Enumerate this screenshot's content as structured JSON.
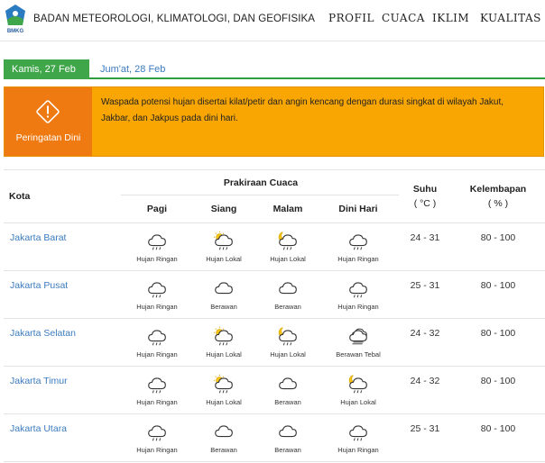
{
  "header": {
    "logo_text": "BMKG",
    "org_name": "BADAN METEOROLOGI, KLIMATOLOGI, DAN GEOFISIKA",
    "nav": [
      "PROFIL",
      "CUACA",
      "IKLIM",
      "KUALITAS UD"
    ]
  },
  "tabs": {
    "active": "Kamis, 27 Feb",
    "other": "Jum'at, 28 Feb"
  },
  "warning": {
    "icon": "warning-diamond-icon",
    "label": "Peringatan Dini",
    "text": "Waspada potensi hujan disertai kilat/petir dan angin kencang dengan durasi singkat di wilayah Jakut, Jakbar, dan Jakpus pada  dini hari."
  },
  "table": {
    "col_city": "Kota",
    "col_forecast": "Prakiraan Cuaca",
    "periods": [
      "Pagi",
      "Siang",
      "Malam",
      "Dini Hari"
    ],
    "col_temp": [
      "Suhu",
      "( °C )"
    ],
    "col_humidity": [
      "Kelembapan",
      "( % )"
    ],
    "rows": [
      {
        "city": "Jakarta Barat",
        "weather": [
          {
            "icon": "light-rain-icon",
            "label": "Hujan Ringan"
          },
          {
            "icon": "sun-rain-icon",
            "label": "Hujan Lokal"
          },
          {
            "icon": "moon-rain-icon",
            "label": "Hujan Lokal"
          },
          {
            "icon": "light-rain-icon",
            "label": "Hujan Ringan"
          }
        ],
        "temp": "24 - 31",
        "humidity": "80 - 100"
      },
      {
        "city": "Jakarta Pusat",
        "weather": [
          {
            "icon": "light-rain-icon",
            "label": "Hujan Ringan"
          },
          {
            "icon": "cloud-icon",
            "label": "Berawan"
          },
          {
            "icon": "cloud-icon",
            "label": "Berawan"
          },
          {
            "icon": "light-rain-icon",
            "label": "Hujan Ringan"
          }
        ],
        "temp": "25 - 31",
        "humidity": "80 - 100"
      },
      {
        "city": "Jakarta Selatan",
        "weather": [
          {
            "icon": "light-rain-icon",
            "label": "Hujan Ringan"
          },
          {
            "icon": "sun-rain-icon",
            "label": "Hujan Lokal"
          },
          {
            "icon": "moon-rain-icon",
            "label": "Hujan Lokal"
          },
          {
            "icon": "heavy-cloud-icon",
            "label": "Berawan Tebal"
          }
        ],
        "temp": "24 - 32",
        "humidity": "80 - 100"
      },
      {
        "city": "Jakarta Timur",
        "weather": [
          {
            "icon": "light-rain-icon",
            "label": "Hujan Ringan"
          },
          {
            "icon": "sun-rain-icon",
            "label": "Hujan Lokal"
          },
          {
            "icon": "cloud-icon",
            "label": "Berawan"
          },
          {
            "icon": "moon-rain-icon",
            "label": "Hujan Lokal"
          }
        ],
        "temp": "24 - 32",
        "humidity": "80 - 100"
      },
      {
        "city": "Jakarta Utara",
        "weather": [
          {
            "icon": "light-rain-icon",
            "label": "Hujan Ringan"
          },
          {
            "icon": "cloud-icon",
            "label": "Berawan"
          },
          {
            "icon": "cloud-icon",
            "label": "Berawan"
          },
          {
            "icon": "light-rain-icon",
            "label": "Hujan Ringan"
          }
        ],
        "temp": "25 - 31",
        "humidity": "80 - 100"
      }
    ]
  },
  "colors": {
    "tab_active": "#3fa64a",
    "warning_bg": "#f9a602",
    "warning_label_bg": "#ef7a12",
    "link": "#3b7bbf"
  }
}
